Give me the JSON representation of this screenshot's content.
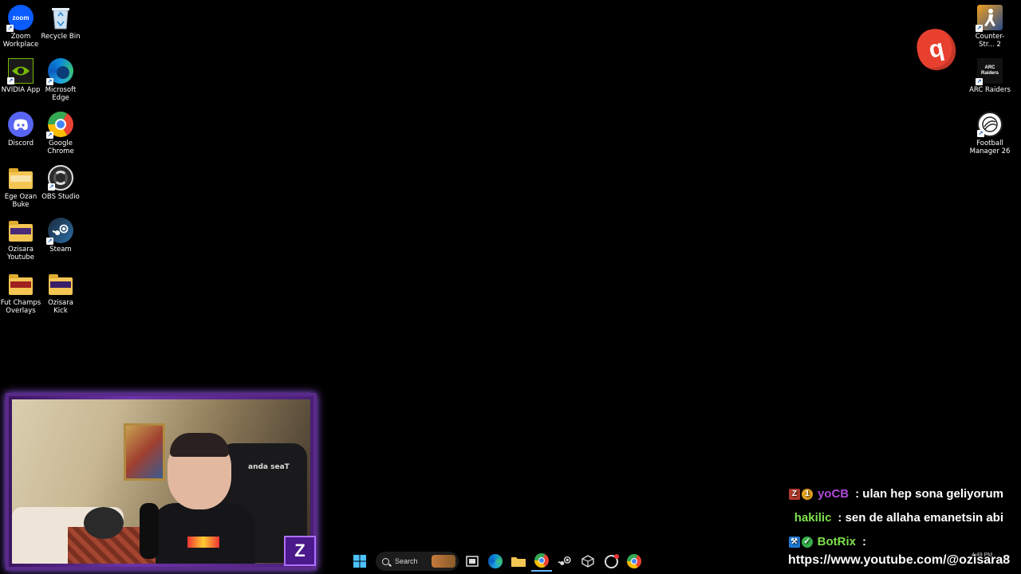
{
  "desktop_icons_left": [
    {
      "label": "Zoom Workplace",
      "icon": "zoom-icon",
      "glyph": "zoom",
      "color": "#0b5cff"
    },
    {
      "label": "Recycle Bin",
      "icon": "recycle-bin-icon"
    },
    {
      "label": "NVIDIA App",
      "icon": "nvidia-icon",
      "color": "#76b900"
    },
    {
      "label": "Microsoft Edge",
      "icon": "edge-icon",
      "color": "#1fa5e0"
    },
    {
      "label": "Discord",
      "icon": "discord-icon",
      "color": "#5865f2"
    },
    {
      "label": "Google Chrome",
      "icon": "chrome-icon"
    },
    {
      "label": "Ege Ozan Buke",
      "icon": "folder-icon"
    },
    {
      "label": "OBS Studio",
      "icon": "obs-icon"
    },
    {
      "label": "Ozisara Youtube",
      "icon": "folder-icon"
    },
    {
      "label": "Steam",
      "icon": "steam-icon",
      "color": "#1b2838"
    },
    {
      "label": "Fut Champs Overlays",
      "icon": "folder-icon"
    },
    {
      "label": "Ozisara Kick",
      "icon": "folder-icon"
    }
  ],
  "desktop_icons_right": [
    {
      "label": "Counter-Str... 2",
      "icon": "counter-strike-icon"
    },
    {
      "label": "ARC Raiders",
      "icon": "arc-raiders-icon",
      "glyph": "ARC Raiders"
    },
    {
      "label": "Football Manager 26",
      "icon": "football-manager-icon"
    }
  ],
  "overlay": {
    "floating_logo_glyph": "q",
    "cam_badge_glyph": "Z",
    "chair_brand": "anda seaT"
  },
  "taskbar": {
    "search_label": "Search",
    "clock": "4:49 PM",
    "apps": [
      "windows-start-icon",
      "search",
      "widgets-icon",
      "task-view-icon",
      "edge-icon",
      "file-explorer-icon",
      "chrome-icon",
      "steam-icon",
      "unity-icon",
      "obs-icon",
      "chrome-icon"
    ]
  },
  "chat": {
    "messages": [
      {
        "user": "yoCB",
        "user_color": "#b04ad8",
        "text": ": ulan hep sona geliyorum",
        "badges": [
          "Z",
          "1"
        ]
      },
      {
        "user": "hakilic",
        "user_color": "#7de04a",
        "text": ": sen de allaha emanetsin abi",
        "badges": []
      },
      {
        "user": "BotRix",
        "user_color": "#7de04a",
        "text": ":",
        "badges": [
          "tool",
          "check"
        ]
      }
    ],
    "url": "https://www.youtube.com/@ozisara8"
  }
}
